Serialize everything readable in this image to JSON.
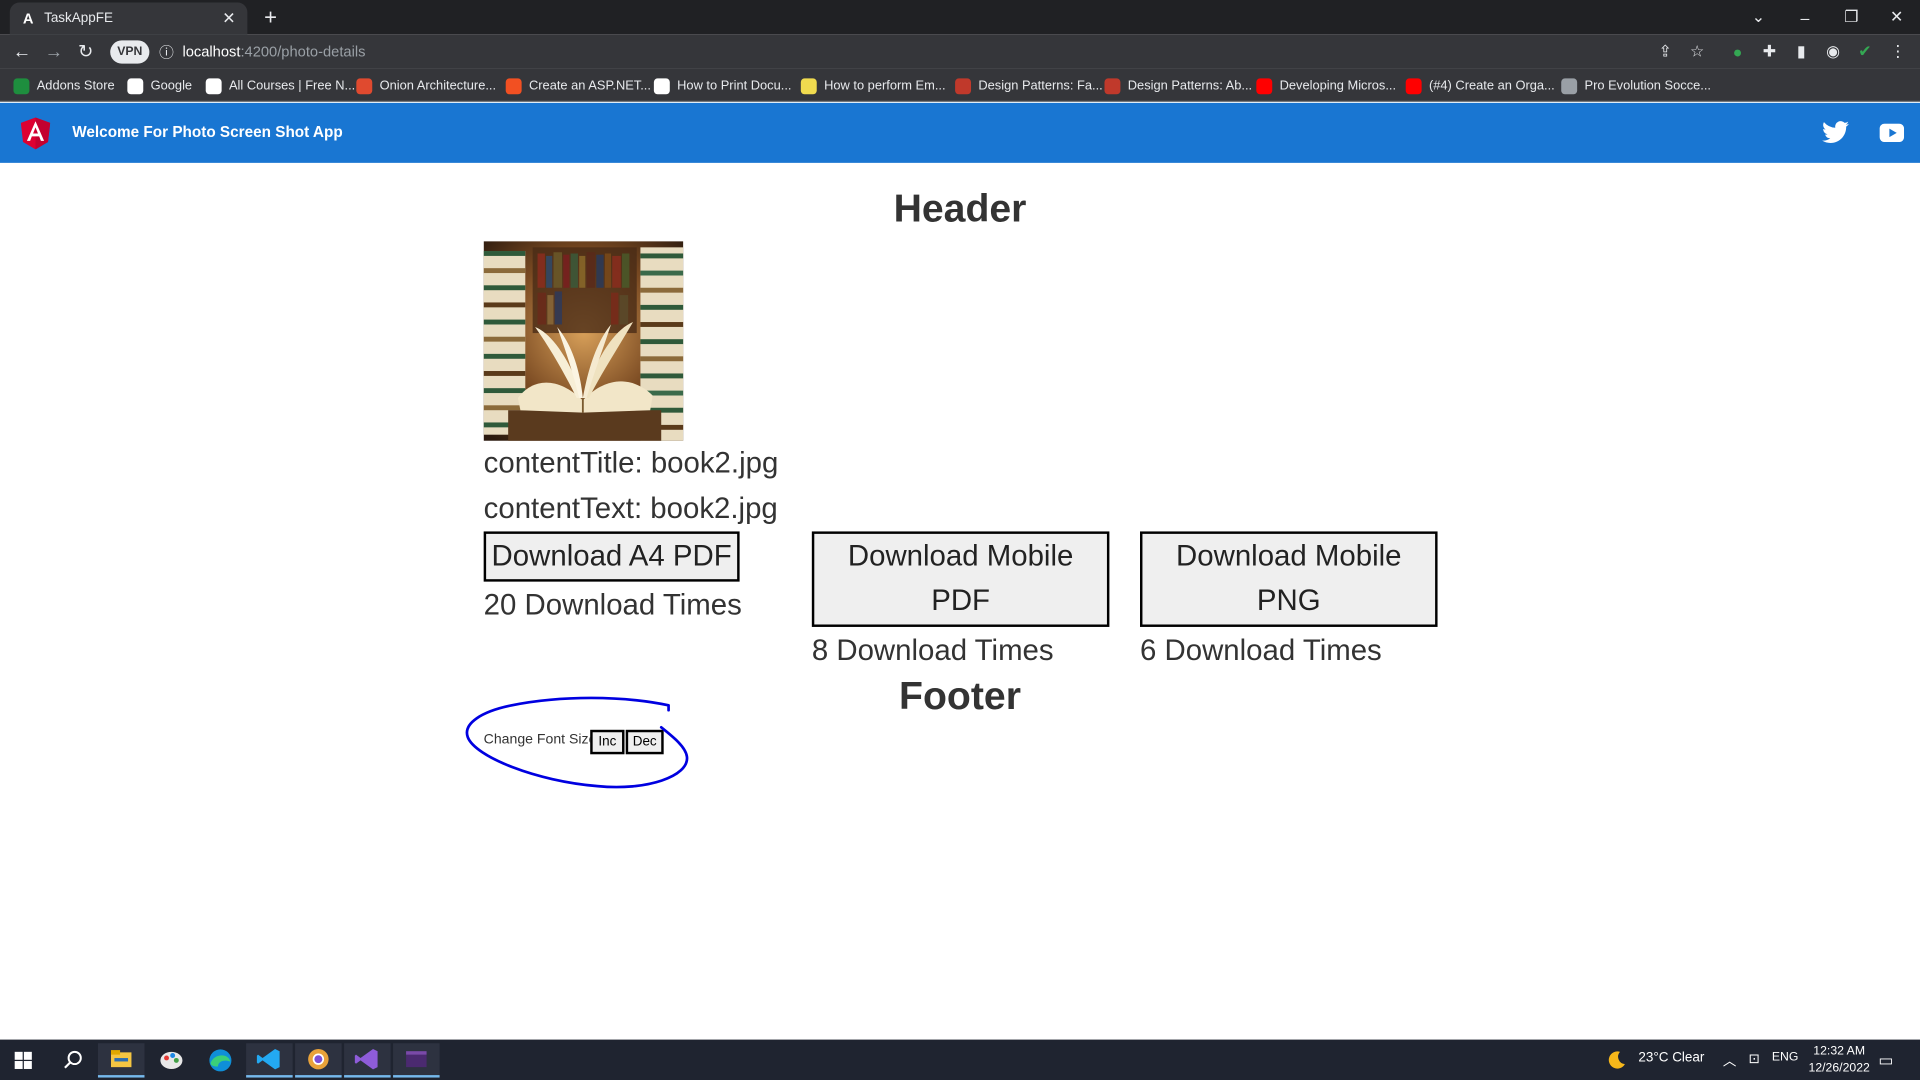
{
  "browser": {
    "tab_title": "TaskAppFE",
    "tab_favicon": "A",
    "vpn_label": "VPN",
    "url_host": "localhost",
    "url_path": ":4200/photo-details",
    "bookmarks": [
      {
        "label": "Addons Store",
        "icon": "store-icon",
        "color": "#1e8e3e"
      },
      {
        "label": "Google",
        "icon": "google-icon",
        "color": "#ffffff"
      },
      {
        "label": "All Courses | Free N...",
        "icon": "courses-icon",
        "color": "#ffffff"
      },
      {
        "label": "Onion Architecture...",
        "icon": "onion-icon",
        "color": "#e04a2f"
      },
      {
        "label": "Create an ASP.NET...",
        "icon": "microsoft-icon",
        "color": "#f25022"
      },
      {
        "label": "How to Print Docu...",
        "icon": "video-icon",
        "color": "#ffffff"
      },
      {
        "label": "How to perform Em...",
        "icon": "ycombinator-icon",
        "color": "#f0db4f"
      },
      {
        "label": "Design Patterns: Fa...",
        "icon": "design-patterns-icon",
        "color": "#c0392b"
      },
      {
        "label": "Design Patterns: Ab...",
        "icon": "design-patterns-icon",
        "color": "#c0392b"
      },
      {
        "label": "Developing Micros...",
        "icon": "youtube-icon",
        "color": "#ff0000"
      },
      {
        "label": "(#4) Create an Orga...",
        "icon": "youtube-icon",
        "color": "#ff0000"
      },
      {
        "label": "Pro Evolution Socce...",
        "icon": "globe-icon",
        "color": "#9aa0a6"
      }
    ]
  },
  "app": {
    "title": "Welcome For Photo Screen Shot App",
    "brand_color": "#1976d2"
  },
  "page": {
    "header": "Header",
    "content_title": "contentTitle: book2.jpg",
    "content_text": "contentText: book2.jpg",
    "downloads": [
      {
        "label": "Download A4 PDF",
        "count_text": "20 Download Times"
      },
      {
        "label": "Download Mobile PDF",
        "count_text": "8 Download Times"
      },
      {
        "label": "Download Mobile PNG",
        "count_text": "6 Download Times"
      }
    ],
    "footer": "Footer",
    "font_size_label": "Change Font Size",
    "inc_label": "Inc",
    "dec_label": "Dec"
  },
  "taskbar": {
    "weather": "23°C  Clear",
    "language": "ENG",
    "time": "12:32 AM",
    "date": "12/26/2022"
  }
}
